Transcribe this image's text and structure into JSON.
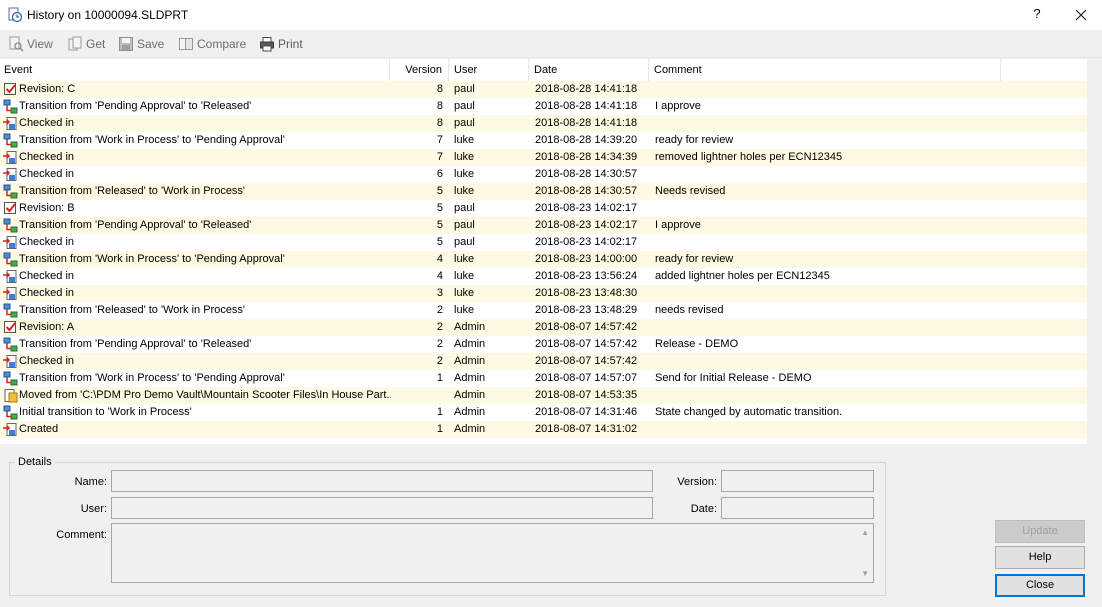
{
  "window": {
    "title": "History on 10000094.SLDPRT",
    "help_glyph": "?"
  },
  "toolbar": {
    "view": "View",
    "get": "Get",
    "save": "Save",
    "compare": "Compare",
    "print": "Print"
  },
  "columns": {
    "event": "Event",
    "version": "Version",
    "user": "User",
    "date": "Date",
    "comment": "Comment"
  },
  "rows": [
    {
      "icon": "revision-icon",
      "event": "Revision: C",
      "version": "8",
      "user": "paul",
      "date": "2018-08-28 14:41:18",
      "comment": ""
    },
    {
      "icon": "transition-icon",
      "event": "Transition from 'Pending Approval' to 'Released'",
      "version": "8",
      "user": "paul",
      "date": "2018-08-28 14:41:18",
      "comment": "I approve"
    },
    {
      "icon": "checkin-icon",
      "event": "Checked in",
      "version": "8",
      "user": "paul",
      "date": "2018-08-28 14:41:18",
      "comment": ""
    },
    {
      "icon": "transition-icon",
      "event": "Transition from 'Work in Process' to 'Pending Approval'",
      "version": "7",
      "user": "luke",
      "date": "2018-08-28 14:39:20",
      "comment": "ready for review"
    },
    {
      "icon": "checkin-icon",
      "event": "Checked in",
      "version": "7",
      "user": "luke",
      "date": "2018-08-28 14:34:39",
      "comment": "removed lightner holes per ECN12345"
    },
    {
      "icon": "checkin-icon",
      "event": "Checked in",
      "version": "6",
      "user": "luke",
      "date": "2018-08-28 14:30:57",
      "comment": ""
    },
    {
      "icon": "transition-icon",
      "event": "Transition from 'Released' to 'Work in Process'",
      "version": "5",
      "user": "luke",
      "date": "2018-08-28 14:30:57",
      "comment": "Needs revised"
    },
    {
      "icon": "revision-icon",
      "event": "Revision: B",
      "version": "5",
      "user": "paul",
      "date": "2018-08-23 14:02:17",
      "comment": ""
    },
    {
      "icon": "transition-icon",
      "event": "Transition from 'Pending Approval' to 'Released'",
      "version": "5",
      "user": "paul",
      "date": "2018-08-23 14:02:17",
      "comment": "I approve"
    },
    {
      "icon": "checkin-icon",
      "event": "Checked in",
      "version": "5",
      "user": "paul",
      "date": "2018-08-23 14:02:17",
      "comment": ""
    },
    {
      "icon": "transition-icon",
      "event": "Transition from 'Work in Process' to 'Pending Approval'",
      "version": "4",
      "user": "luke",
      "date": "2018-08-23 14:00:00",
      "comment": "ready for review"
    },
    {
      "icon": "checkin-icon",
      "event": "Checked in",
      "version": "4",
      "user": "luke",
      "date": "2018-08-23 13:56:24",
      "comment": "added lightner holes per ECN12345"
    },
    {
      "icon": "checkin-icon",
      "event": "Checked in",
      "version": "3",
      "user": "luke",
      "date": "2018-08-23 13:48:30",
      "comment": ""
    },
    {
      "icon": "transition-icon",
      "event": "Transition from 'Released' to 'Work in Process'",
      "version": "2",
      "user": "luke",
      "date": "2018-08-23 13:48:29",
      "comment": "needs revised"
    },
    {
      "icon": "revision-icon",
      "event": "Revision: A",
      "version": "2",
      "user": "Admin",
      "date": "2018-08-07 14:57:42",
      "comment": ""
    },
    {
      "icon": "transition-icon",
      "event": "Transition from 'Pending Approval' to 'Released'",
      "version": "2",
      "user": "Admin",
      "date": "2018-08-07 14:57:42",
      "comment": "Release - DEMO"
    },
    {
      "icon": "checkin-icon",
      "event": "Checked in",
      "version": "2",
      "user": "Admin",
      "date": "2018-08-07 14:57:42",
      "comment": ""
    },
    {
      "icon": "transition-icon",
      "event": "Transition from 'Work in Process' to 'Pending Approval'",
      "version": "1",
      "user": "Admin",
      "date": "2018-08-07 14:57:07",
      "comment": "Send for Initial Release - DEMO"
    },
    {
      "icon": "move-icon",
      "event": "Moved from 'C:\\PDM Pro Demo Vault\\Mountain Scooter Files\\In House Part...",
      "version": "",
      "user": "Admin",
      "date": "2018-08-07 14:53:35",
      "comment": ""
    },
    {
      "icon": "transition-icon",
      "event": "Initial transition to 'Work in Process'",
      "version": "1",
      "user": "Admin",
      "date": "2018-08-07 14:31:46",
      "comment": "State changed by automatic transition."
    },
    {
      "icon": "checkin-icon",
      "event": "Created",
      "version": "1",
      "user": "Admin",
      "date": "2018-08-07 14:31:02",
      "comment": ""
    }
  ],
  "details": {
    "title": "Details",
    "name_label": "Name:",
    "version_label": "Version:",
    "user_label": "User:",
    "date_label": "Date:",
    "comment_label": "Comment:",
    "name_value": "",
    "version_value": "",
    "user_value": "",
    "date_value": "",
    "comment_value": ""
  },
  "buttons": {
    "update": "Update",
    "help": "Help",
    "close": "Close"
  }
}
